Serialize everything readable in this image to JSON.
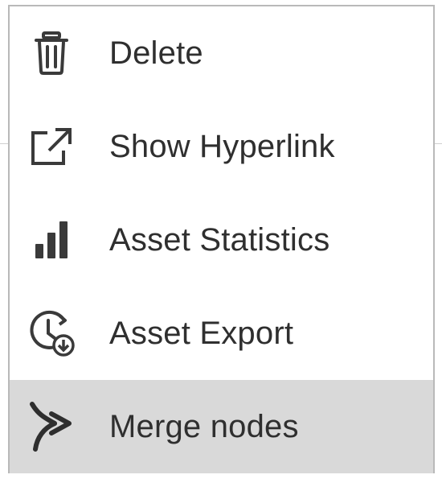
{
  "menu": {
    "items": [
      {
        "label": "Delete",
        "icon": "trash-icon",
        "highlighted": false
      },
      {
        "label": "Show Hyperlink",
        "icon": "external-link-icon",
        "highlighted": false
      },
      {
        "label": "Asset Statistics",
        "icon": "bar-chart-icon",
        "highlighted": false
      },
      {
        "label": "Asset Export",
        "icon": "clock-download-icon",
        "highlighted": false
      },
      {
        "label": "Merge nodes",
        "icon": "merge-arrow-icon",
        "highlighted": true
      }
    ]
  },
  "colors": {
    "text": "#2f2f2f",
    "icon": "#3a3a3a",
    "highlight": "#d9d9d9",
    "border": "#b9b9b9"
  }
}
